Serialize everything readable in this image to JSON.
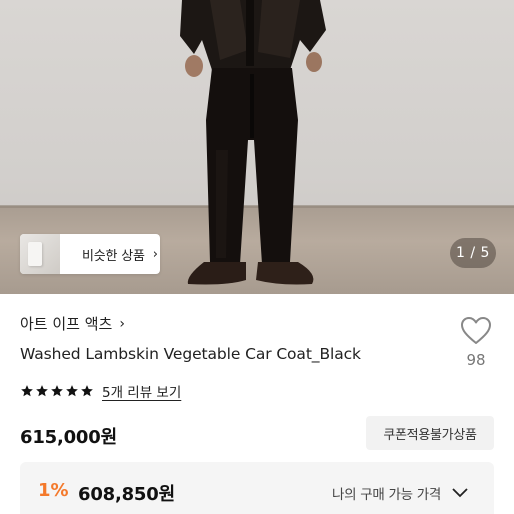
{
  "gallery": {
    "similar_label": "비슷한 상품",
    "similar_chevron": "›",
    "counter": "1 / 5"
  },
  "product": {
    "brand": "아트 이프 액츠",
    "brand_chevron": "›",
    "title": "Washed Lambskin Vegetable Car Coat_Black",
    "likes": "98",
    "rating_stars": 5,
    "review_link": "5개 리뷰 보기",
    "price": "615,000원",
    "coupon_button": "쿠폰적용불가상품"
  },
  "my_price": {
    "discount": "1%",
    "price": "608,850원",
    "label": "나의 구매 가능 가격"
  },
  "colors": {
    "accent": "#f4792b",
    "star": "#111111",
    "heart_stroke": "#888888"
  }
}
